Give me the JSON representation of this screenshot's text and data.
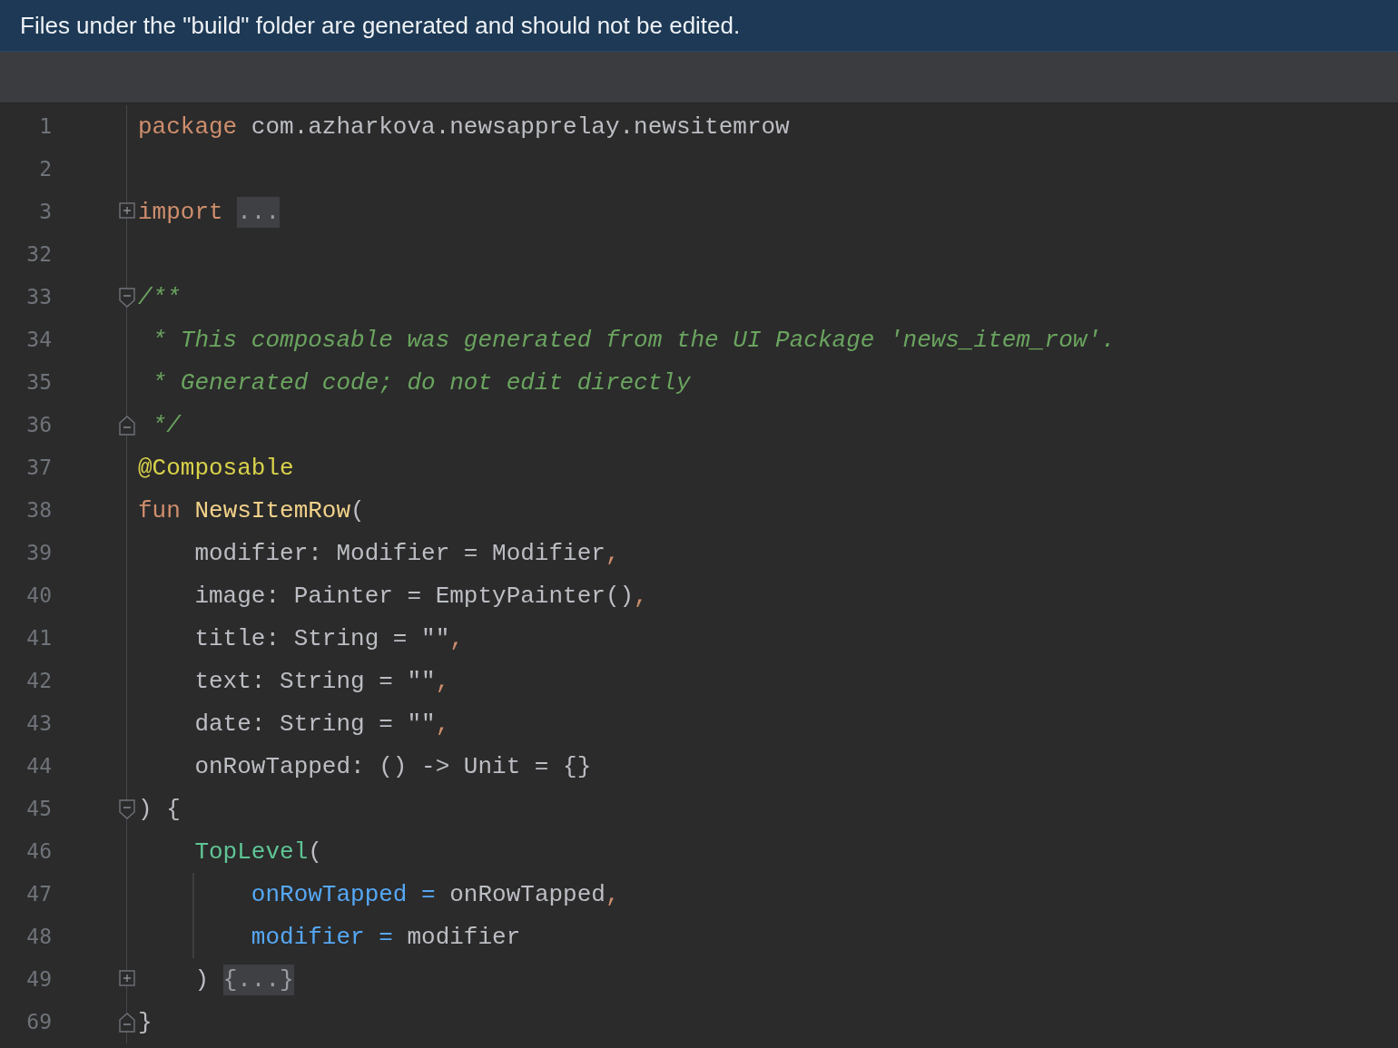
{
  "banner": {
    "text": "Files under the \"build\" folder are generated and should not be edited."
  },
  "lines": [
    {
      "number": "1",
      "tokens": [
        {
          "text": "package ",
          "kind": "keyword"
        },
        {
          "text": "com.azharkova.newsapprelay.newsitemrow",
          "kind": "plain"
        }
      ]
    },
    {
      "number": "2"
    },
    {
      "number": "3",
      "fold_marker": {
        "kind": "expand"
      },
      "tokens": [
        {
          "text": "import ",
          "kind": "keyword"
        },
        {
          "text": "...",
          "kind": "folded"
        }
      ]
    },
    {
      "number": "32"
    },
    {
      "number": "33",
      "fold_marker": {
        "kind": "start"
      },
      "tokens": [
        {
          "text": "/**",
          "kind": "comment"
        }
      ]
    },
    {
      "number": "34",
      "tokens": [
        {
          "text": " * This composable was generated from the UI Package 'news_item_row'.",
          "kind": "comment"
        }
      ]
    },
    {
      "number": "35",
      "tokens": [
        {
          "text": " * Generated code; do not edit directly",
          "kind": "comment"
        }
      ]
    },
    {
      "number": "36",
      "fold_marker": {
        "kind": "end"
      },
      "tokens": [
        {
          "text": " */",
          "kind": "comment"
        }
      ]
    },
    {
      "number": "37",
      "tokens": [
        {
          "text": "@Composable",
          "kind": "annotation"
        }
      ]
    },
    {
      "number": "38",
      "tokens": [
        {
          "text": "fun ",
          "kind": "keyword"
        },
        {
          "text": "NewsItemRow",
          "kind": "declaration"
        },
        {
          "text": "(",
          "kind": "plain"
        }
      ]
    },
    {
      "number": "39",
      "tokens": [
        {
          "text": "    modifier: Modifier = Modifier",
          "kind": "plain"
        },
        {
          "text": ",",
          "kind": "keyword"
        }
      ]
    },
    {
      "number": "40",
      "tokens": [
        {
          "text": "    image: Painter = EmptyPainter()",
          "kind": "plain"
        },
        {
          "text": ",",
          "kind": "keyword"
        }
      ]
    },
    {
      "number": "41",
      "tokens": [
        {
          "text": "    title: String = \"\"",
          "kind": "plain"
        },
        {
          "text": ",",
          "kind": "keyword"
        }
      ]
    },
    {
      "number": "42",
      "tokens": [
        {
          "text": "    text: String = \"\"",
          "kind": "plain"
        },
        {
          "text": ",",
          "kind": "keyword"
        }
      ]
    },
    {
      "number": "43",
      "tokens": [
        {
          "text": "    date: String = \"\"",
          "kind": "plain"
        },
        {
          "text": ",",
          "kind": "keyword"
        }
      ]
    },
    {
      "number": "44",
      "tokens": [
        {
          "text": "    onRowTapped: () -> Unit = {}",
          "kind": "plain"
        }
      ]
    },
    {
      "number": "45",
      "fold_marker": {
        "kind": "start"
      },
      "tokens": [
        {
          "text": ") {",
          "kind": "plain"
        }
      ]
    },
    {
      "number": "46",
      "tokens": [
        {
          "text": "    TopLevel",
          "kind": "call"
        },
        {
          "text": "(",
          "kind": "plain"
        }
      ]
    },
    {
      "number": "47",
      "indent_guide": true,
      "tokens": [
        {
          "text": "        onRowTapped = ",
          "kind": "named"
        },
        {
          "text": "onRowTapped",
          "kind": "plain"
        },
        {
          "text": ",",
          "kind": "keyword"
        }
      ]
    },
    {
      "number": "48",
      "indent_guide": true,
      "tokens": [
        {
          "text": "        modifier = ",
          "kind": "named"
        },
        {
          "text": "modifier",
          "kind": "plain"
        }
      ]
    },
    {
      "number": "49",
      "fold_marker": {
        "kind": "expand"
      },
      "tokens": [
        {
          "text": "    ) ",
          "kind": "plain"
        },
        {
          "text": "{...}",
          "kind": "folded"
        }
      ]
    },
    {
      "number": "69",
      "fold_marker": {
        "kind": "end"
      },
      "tokens": [
        {
          "text": "}",
          "kind": "plain"
        }
      ]
    }
  ]
}
